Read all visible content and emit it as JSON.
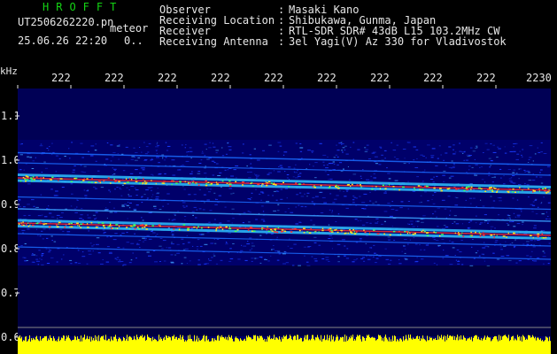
{
  "header": {
    "logo": "HROFFT",
    "filename": "UT2506262220.pn",
    "meteor_label": "meteor",
    "datetime": "25.06.26 22:20",
    "count": "0.."
  },
  "station_info": [
    {
      "label": "Observer",
      "value": "Masaki Kano"
    },
    {
      "label": "Receiving Location",
      "value": "Shibukawa, Gunma, Japan"
    },
    {
      "label": "Receiver",
      "value": "RTL-SDR SDR# 43dB L15 103.2MHz CW"
    },
    {
      "label": "Receiving Antenna",
      "value": "3el Yagi(V) Az 330 for Vladivostok"
    }
  ],
  "x_axis": {
    "ticks": [
      "222",
      "222",
      "222",
      "222",
      "222",
      "222",
      "222",
      "222",
      "222",
      "2230"
    ]
  },
  "y_axis": {
    "unit": "kHz",
    "ticks": [
      "1.1",
      "1.0",
      "0.9",
      "0.8",
      "0.7",
      "0.6"
    ],
    "range": [
      0.6,
      1.1
    ]
  },
  "colors": {
    "background": "#000000",
    "logo": "#14d414",
    "text": "#e6e6e6",
    "power_bar": "#ffff00"
  }
}
